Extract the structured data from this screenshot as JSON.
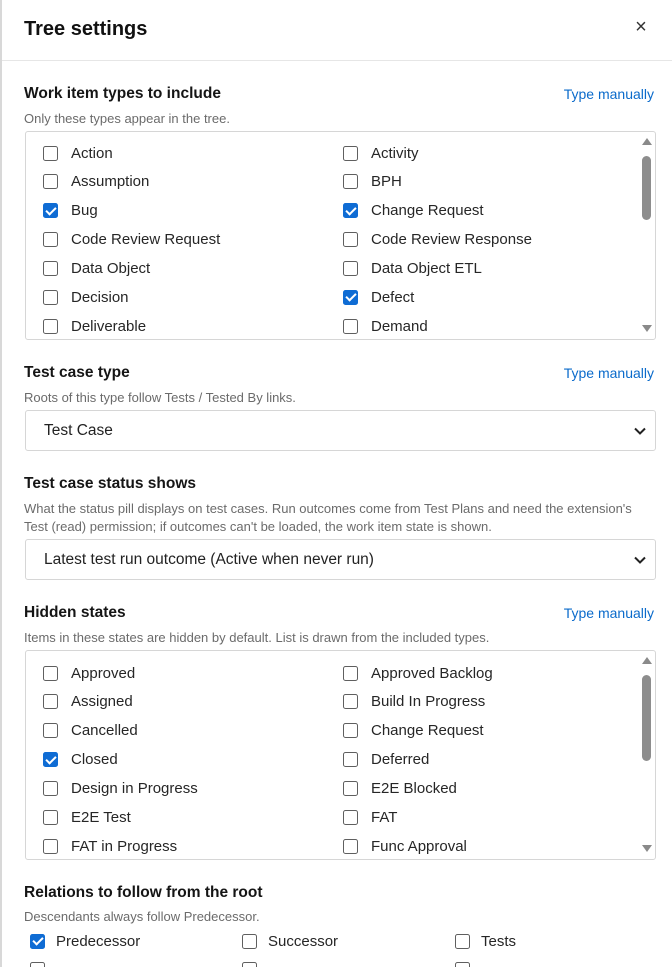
{
  "header": {
    "title": "Tree settings",
    "close_glyph": "×"
  },
  "work_item_types": {
    "title": "Work item types to include",
    "type_manually": "Type manually",
    "desc": "Only these types appear in the tree.",
    "items": [
      {
        "label": "Action",
        "checked": false
      },
      {
        "label": "Activity",
        "checked": false
      },
      {
        "label": "Assumption",
        "checked": false
      },
      {
        "label": "BPH",
        "checked": false
      },
      {
        "label": "Bug",
        "checked": true
      },
      {
        "label": "Change Request",
        "checked": true
      },
      {
        "label": "Code Review Request",
        "checked": false
      },
      {
        "label": "Code Review Response",
        "checked": false
      },
      {
        "label": "Data Object",
        "checked": false
      },
      {
        "label": "Data Object ETL",
        "checked": false
      },
      {
        "label": "Decision",
        "checked": false
      },
      {
        "label": "Defect",
        "checked": true
      },
      {
        "label": "Deliverable",
        "checked": false
      },
      {
        "label": "Demand",
        "checked": false
      }
    ]
  },
  "test_case_type": {
    "title": "Test case type",
    "type_manually": "Type manually",
    "desc": "Roots of this type follow Tests / Tested By links.",
    "selected": "Test Case"
  },
  "test_case_status": {
    "title": "Test case status shows",
    "desc": "What the status pill displays on test cases. Run outcomes come from Test Plans and need the extension's Test (read) permission; if outcomes can't be loaded, the work item state is shown.",
    "selected": "Latest test run outcome (Active when never run)"
  },
  "hidden_states": {
    "title": "Hidden states",
    "type_manually": "Type manually",
    "desc": "Items in these states are hidden by default. List is drawn from the included types.",
    "items": [
      {
        "label": "Approved",
        "checked": false
      },
      {
        "label": "Approved Backlog",
        "checked": false
      },
      {
        "label": "Assigned",
        "checked": false
      },
      {
        "label": "Build In Progress",
        "checked": false
      },
      {
        "label": "Cancelled",
        "checked": false
      },
      {
        "label": "Change Request",
        "checked": false
      },
      {
        "label": "Closed",
        "checked": true
      },
      {
        "label": "Deferred",
        "checked": false
      },
      {
        "label": "Design in Progress",
        "checked": false
      },
      {
        "label": "E2E Blocked",
        "checked": false
      },
      {
        "label": "E2E Test",
        "checked": false
      },
      {
        "label": "FAT",
        "checked": false
      },
      {
        "label": "FAT in Progress",
        "checked": false
      },
      {
        "label": "Func Approval",
        "checked": false
      }
    ]
  },
  "relations": {
    "title": "Relations to follow from the root",
    "desc": "Descendants always follow Predecessor.",
    "items": [
      {
        "label": "Predecessor",
        "checked": true
      },
      {
        "label": "Successor",
        "checked": false
      },
      {
        "label": "Tests",
        "checked": false
      }
    ]
  },
  "icons": {
    "close": "close-icon",
    "chevron": "chevron-down-icon",
    "scroll_up": "scroll-up-arrow-icon",
    "scroll_down": "scroll-down-arrow-icon"
  },
  "colors": {
    "accent": "#0f6cd4",
    "link": "#0b6bcb",
    "border": "#d6d6d6",
    "muted_text": "#6b6b6b"
  }
}
